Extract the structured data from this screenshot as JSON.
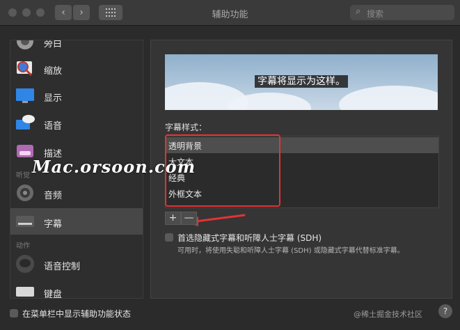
{
  "window": {
    "title": "辅助功能"
  },
  "search": {
    "placeholder": "搜索"
  },
  "sidebar": {
    "items": [
      {
        "label": "旁白",
        "icon": "voiceover-icon"
      },
      {
        "label": "缩放",
        "icon": "zoom-icon"
      },
      {
        "label": "显示",
        "icon": "display-icon"
      },
      {
        "label": "语音",
        "icon": "speech-icon"
      },
      {
        "label": "描述",
        "icon": "descriptions-icon"
      },
      {
        "label": "音频",
        "icon": "audio-icon"
      },
      {
        "label": "字幕",
        "icon": "captions-icon"
      },
      {
        "label": "语音控制",
        "icon": "voice-control-icon"
      },
      {
        "label": "键盘",
        "icon": "keyboard-icon"
      }
    ],
    "sections": {
      "hearing": "听觉",
      "motor": "动作"
    }
  },
  "main": {
    "preview_caption": "字幕将显示为这样。",
    "style_label": "字幕样式：",
    "styles": [
      "透明背景",
      "大文本",
      "经典",
      "外框文本"
    ],
    "add_label": "+",
    "remove_label": "—",
    "sdh_label": "首选隐藏式字幕和听障人士字幕 (SDH)",
    "sdh_note": "可用时，将使用失聪和听障人士字幕 (SDH) 或隐藏式字幕代替标准字幕。"
  },
  "footer": {
    "menu_status_label": "在菜单栏中显示辅助功能状态",
    "help_label": "?"
  },
  "overlay": {
    "watermark": "Mac.orsoon.com",
    "credit": "@稀土掘金技术社区"
  }
}
